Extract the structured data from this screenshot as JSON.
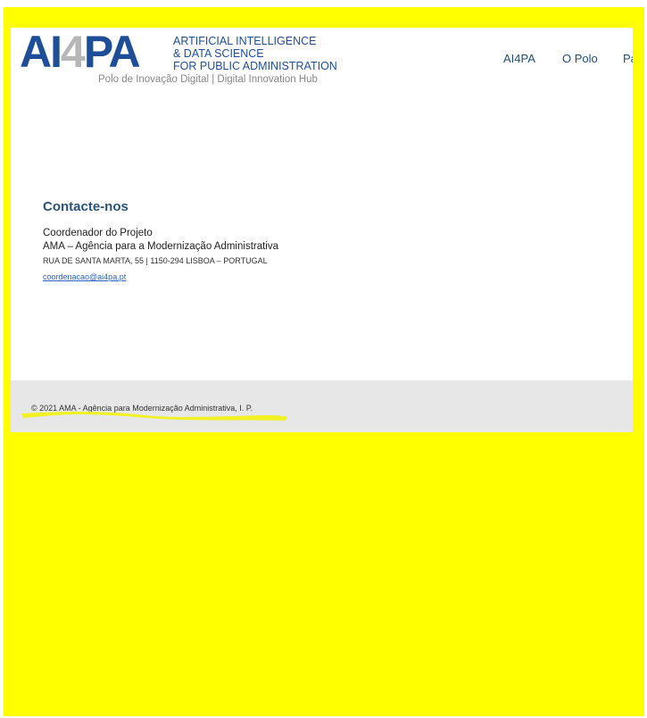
{
  "header": {
    "logo": {
      "mark_prefix": "AI",
      "mark_digit": "4",
      "mark_suffix": "PA",
      "line1": "ARTIFICIAL INTELLIGENCE",
      "line2": "& DATA SCIENCE",
      "line3": "FOR PUBLIC ADMINISTRATION",
      "tagline": "Polo de Inovação Digital | Digital Innovation Hub"
    },
    "nav": {
      "items": [
        {
          "label": "AI4PA"
        },
        {
          "label": "O Polo"
        },
        {
          "label": "Pa"
        }
      ]
    }
  },
  "contact": {
    "title": "Contacte-nos",
    "role": "Coordenador do Projeto",
    "organization": "AMA – Agência para a Modernização Administrativa",
    "address": "RUA DE SANTA MARTA, 55 | 1150-294 LISBOA – PORTUGAL",
    "email": "coordenacao@ai4pa.pt"
  },
  "footer": {
    "copyright": "© 2021 AMA - Agência para Modernização Administrativa, I. P."
  },
  "colors": {
    "highlight": "#ffff00",
    "brand_blue": "#1f4e99",
    "footer_bg": "#e7e7e7"
  }
}
